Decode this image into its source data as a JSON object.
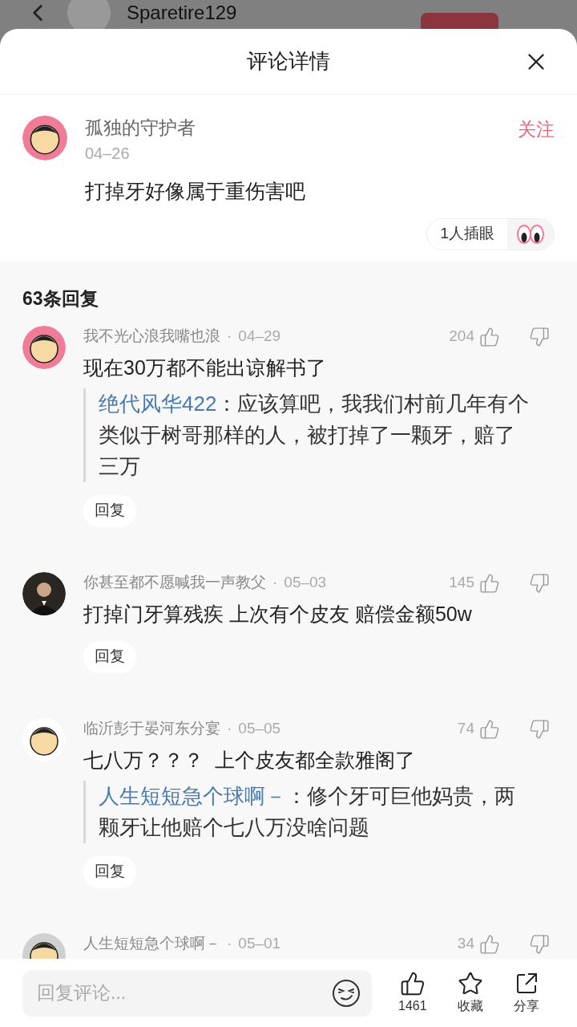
{
  "background_page": {
    "username": "Sparetire129"
  },
  "sheet": {
    "title": "评论详情"
  },
  "comment": {
    "author": "孤独的守护者",
    "date": "04–26",
    "follow": "关注",
    "text": "打掉牙好像属于重伤害吧",
    "reaction": "1人插眼",
    "avatar": {
      "kind": "cartoon",
      "color": "#f07c98"
    }
  },
  "replies_header": "63条回复",
  "replies": [
    {
      "author": "我不光心浪我嘴也浪",
      "dot": "·",
      "date": "04–29",
      "likes": "204",
      "text": "现在30万都不能出谅解书了",
      "quote": {
        "author": "绝代风华422",
        "text": "：应该算吧，我我们村前几年有个类似于树哥那样的人，被打掉了一颗牙，赔了三万"
      },
      "reply_button": "回复",
      "avatar": {
        "kind": "cartoon",
        "color": "#f07c98"
      }
    },
    {
      "author": "你甚至都不愿喊我一声教父",
      "dot": "·",
      "date": "05–03",
      "likes": "145",
      "text": "打掉门牙算残疾 上次有个皮友 赔偿金额50w",
      "reply_button": "回复",
      "avatar": {
        "kind": "photo",
        "color": "#2a2622"
      }
    },
    {
      "author": "临沂彭于晏河东分宴",
      "dot": "·",
      "date": "05–05",
      "likes": "74",
      "text": "七八万？？？  上个皮友都全款雅阁了",
      "quote": {
        "author": "人生短短急个球啊－",
        "text": "：修个牙可巨他妈贵，两颗牙让他赔个七八万没啥问题"
      },
      "reply_button": "回复",
      "avatar": {
        "kind": "cartoon",
        "color": "#ffffff"
      }
    },
    {
      "author": "人生短短急个球啊－",
      "dot": "·",
      "date": "05–01",
      "likes": "34",
      "avatar": {
        "kind": "cartoon",
        "color": "#d0d0d0"
      }
    }
  ],
  "bottom_bar": {
    "placeholder": "回复评论...",
    "likes": "1461",
    "favorite": "收藏",
    "share": "分享"
  }
}
